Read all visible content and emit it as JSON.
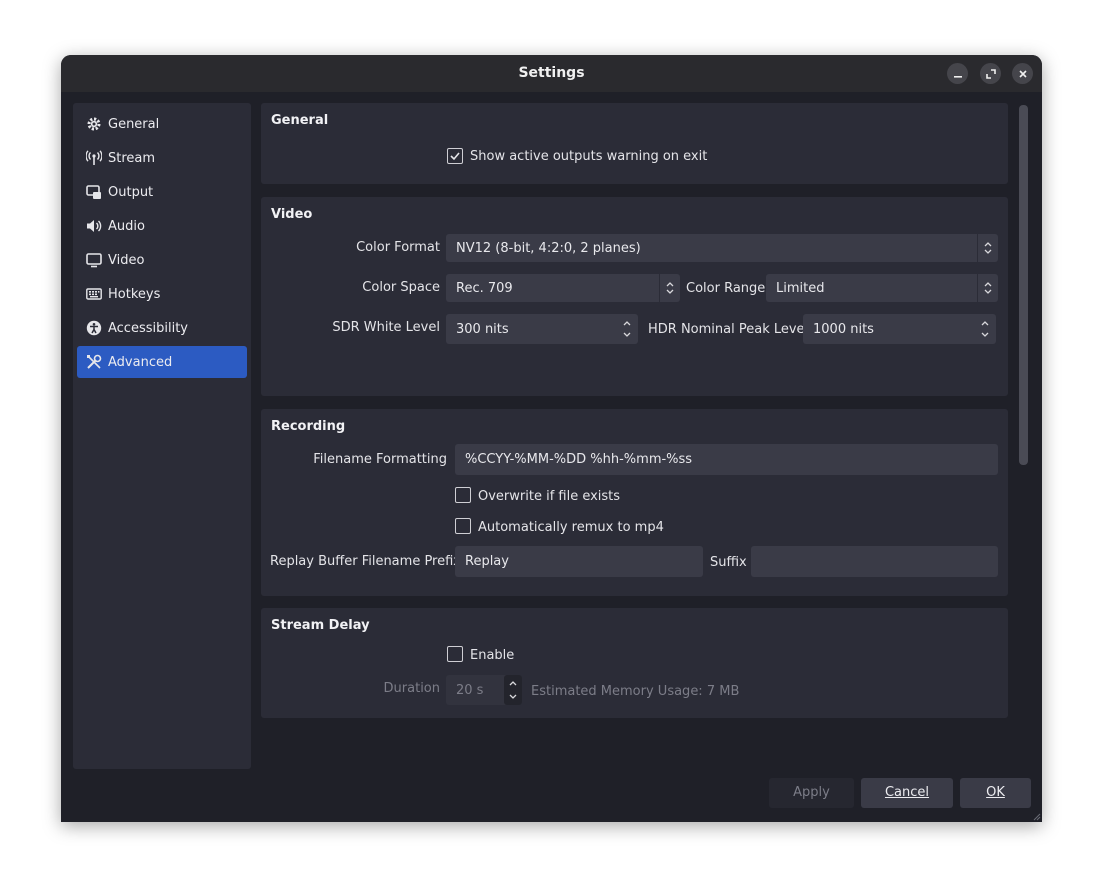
{
  "window": {
    "title": "Settings",
    "controls": {
      "minimize": "–",
      "restore": "⤢",
      "close": "✕"
    }
  },
  "sidebar": {
    "items": [
      {
        "label": "General",
        "icon": "gear-icon"
      },
      {
        "label": "Stream",
        "icon": "antenna-icon"
      },
      {
        "label": "Output",
        "icon": "output-icon"
      },
      {
        "label": "Audio",
        "icon": "speaker-icon"
      },
      {
        "label": "Video",
        "icon": "monitor-icon"
      },
      {
        "label": "Hotkeys",
        "icon": "keyboard-icon"
      },
      {
        "label": "Accessibility",
        "icon": "accessibility-icon"
      },
      {
        "label": "Advanced",
        "icon": "tools-icon",
        "selected": true
      }
    ]
  },
  "general": {
    "title": "General",
    "show_warning_label": "Show active outputs warning on exit",
    "show_warning_checked": true
  },
  "video": {
    "title": "Video",
    "color_format_label": "Color Format",
    "color_format_value": "NV12 (8-bit, 4:2:0, 2 planes)",
    "color_space_label": "Color Space",
    "color_space_value": "Rec. 709",
    "color_range_label": "Color Range",
    "color_range_value": "Limited",
    "sdr_white_label": "SDR White Level",
    "sdr_white_value": "300 nits",
    "hdr_peak_label": "HDR Nominal Peak Level",
    "hdr_peak_value": "1000 nits"
  },
  "recording": {
    "title": "Recording",
    "filename_label": "Filename Formatting",
    "filename_value": "%CCYY-%MM-%DD %hh-%mm-%ss",
    "overwrite_label": "Overwrite if file exists",
    "overwrite_checked": false,
    "remux_label": "Automatically remux to mp4",
    "remux_checked": false,
    "replay_prefix_label": "Replay Buffer Filename Prefix",
    "replay_prefix_value": "Replay",
    "suffix_label": "Suffix",
    "suffix_value": ""
  },
  "stream_delay": {
    "title": "Stream Delay",
    "enable_label": "Enable",
    "enable_checked": false,
    "duration_label": "Duration",
    "duration_value": "20 s",
    "memory_label": "Estimated Memory Usage: 7 MB"
  },
  "buttons": {
    "apply": "Apply",
    "cancel": "Cancel",
    "ok": "OK"
  },
  "colors": {
    "window_bg": "#1f2028",
    "panel_bg": "#2b2c37",
    "field_bg": "#3a3b47",
    "accent": "#2c5bc2"
  }
}
